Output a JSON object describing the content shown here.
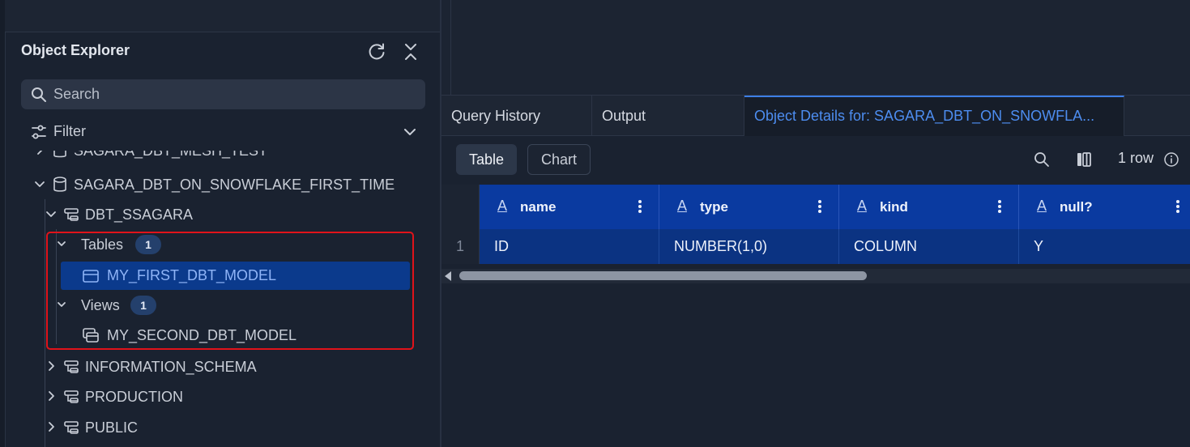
{
  "object_explorer": {
    "title": "Object Explorer",
    "search_placeholder": "Search",
    "filter_label": "Filter"
  },
  "tree": {
    "partial_item": "SAGARA_DBT_MESH_TEST",
    "database": "SAGARA_DBT_ON_SNOWFLAKE_FIRST_TIME",
    "schema": "DBT_SSAGARA",
    "tables_label": "Tables",
    "tables_count": "1",
    "table_item": "MY_FIRST_DBT_MODEL",
    "views_label": "Views",
    "views_count": "1",
    "view_item": "MY_SECOND_DBT_MODEL",
    "other_schemas": [
      "INFORMATION_SCHEMA",
      "PRODUCTION",
      "PUBLIC"
    ]
  },
  "tabs": [
    {
      "label": "Query History"
    },
    {
      "label": "Output"
    },
    {
      "label": "Object Details for: SAGARA_DBT_ON_SNOWFLA..."
    }
  ],
  "toolbar": {
    "table_label": "Table",
    "chart_label": "Chart",
    "row_count": "1 row"
  },
  "grid": {
    "type_icon": "A",
    "columns": [
      "name",
      "type",
      "kind",
      "null?"
    ],
    "rows": [
      {
        "num": "1",
        "cells": [
          "ID",
          "NUMBER(1,0)",
          "COLUMN",
          "Y"
        ]
      }
    ]
  },
  "colors": {
    "selected": "#0b3a8c",
    "header": "#0a3aa0",
    "accent": "#4d8df0",
    "highlight_box": "#e0131a"
  }
}
